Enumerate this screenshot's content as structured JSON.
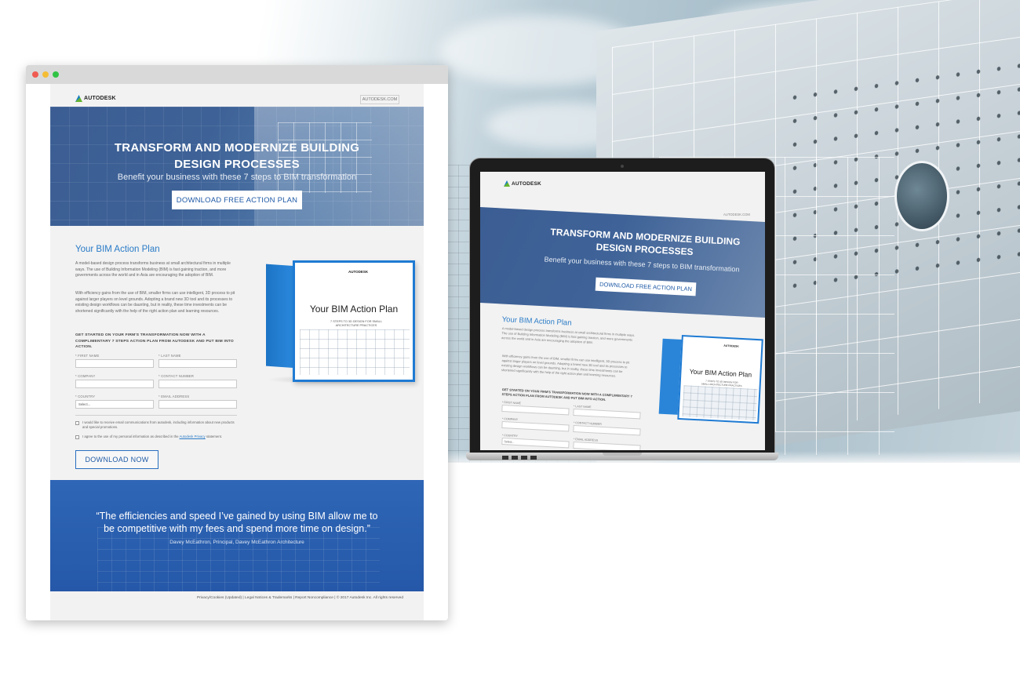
{
  "landing_page": {
    "logo_text": "AUTODESK",
    "site_link": "AUTODESK.COM",
    "hero": {
      "title_line1": "TRANSFORM AND MODERNIZE BUILDING",
      "title_line2": "DESIGN PROCESSES",
      "subtitle": "Benefit your business with these 7 steps to BIM transformation",
      "button_label": "DOWNLOAD FREE ACTION PLAN"
    },
    "section": {
      "title": "Your BIM Action Plan",
      "paragraph1": "A model-based design process transforms business at small architectural firms in multiple ways. The use of Building Information Modeling (BIM) is fast gaining traction, and more governments across the world and in Asia are encouraging the adoption of BIM.",
      "paragraph2": "With efficiency gains from the use of BIM, smaller firms can use intelligent, 3D process to pit against larger players on level grounds. Adopting a brand new 3D tool and its processes to existing design workflows can be daunting, but in reality, these time investments can be shortened significantly with the help of the right action plan and learning resources.",
      "cta": "GET STARTED ON YOUR FIRM'S TRANSFORMATION NOW WITH A COMPLIMENTARY 7 STEPS ACTION PLAN FROM AUTODESK AND PUT BIM INTO ACTION."
    },
    "form": {
      "first_name_label": "* FIRST NAME",
      "last_name_label": "* LAST NAME",
      "company_label": "* COMPANY",
      "contact_number_label": "* CONTACT NUMBER",
      "country_label": "* COUNTRY",
      "email_label": "* EMAIL ADDRESS",
      "country_value": "Select...",
      "checkbox1_text": "I would like to receive email communications from autodesk, including information about new products and special promotions.",
      "checkbox2_text": "I agree to the use of my personal information as described in the",
      "checkbox2_link": "Autodesk Privacy",
      "checkbox2_tail": "statement.",
      "submit_label": "DOWNLOAD NOW"
    },
    "book": {
      "logo": "AUTODESK",
      "title": "Your BIM Action Plan",
      "subtitle": "7 STEPS TO 3D DESIGN FOR SMALL ARCHITECTURE PRACTICES"
    },
    "quote": {
      "text_line1": "“The efficiencies and speed I’ve gained by using BIM allow me to",
      "text_line2": "be competitive with my fees and spend more time on design.”",
      "author": "Davey McEathron, Principal, Davey McEathron Architecture"
    },
    "footer": "Privacy/Cookies (Updated) | Legal Notices & Trademarks | Report Noncompliance | © 2017 Autodesk Inc. All rights reserved"
  },
  "laptop_page": {
    "logo_text": "AUTODESK",
    "site_link": "AUTODESK.COM",
    "hero_title_line1": "TRANSFORM AND MODERNIZE BUILDING",
    "hero_title_line2": "DESIGN PROCESSES",
    "hero_subtitle": "Benefit your business with these 7 steps to BIM transformation",
    "hero_button": "DOWNLOAD FREE ACTION PLAN",
    "section_title": "Your BIM Action Plan",
    "paragraph1": "A model-based design process transforms business at small architectural firms in multiple ways. The use of Building Information Modeling (BIM) is fast gaining traction, and more governments across the world and in Asia are encouraging the adoption of BIM.",
    "paragraph2": "With efficiency gains from the use of BIM, smaller firms can use intelligent, 3D process to pit against larger players on level grounds. Adopting a brand new 3D tool and its processes to existing design workflows can be daunting, but in reality, these time investments can be shortened significantly with the help of the right action plan and learning resources.",
    "cta": "GET STARTED ON YOUR FIRM'S TRANSFORMATION NOW WITH A COMPLIMENTARY 7 STEPS ACTION PLAN FROM AUTODESK AND PUT BIM INTO ACTION.",
    "first_name_label": "* FIRST NAME",
    "last_name_label": "* LAST NAME",
    "company_label": "* COMPANY",
    "contact_number_label": "* CONTACT NUMBER",
    "country_label": "* COUNTRY",
    "email_label": "* EMAIL ADDRESS",
    "country_value": "Select...",
    "book_logo": "AUTODESK",
    "book_title": "Your BIM Action Plan",
    "book_subtitle": "7 STEPS TO 3D DESIGN FOR SMALL ARCHITECTURE PRACTICES"
  },
  "colors": {
    "accent_blue": "#2a7bc7",
    "hero_blue": "#3b5d93",
    "quote_blue": "#2f66b6",
    "page_bg": "#f2f2f2"
  }
}
